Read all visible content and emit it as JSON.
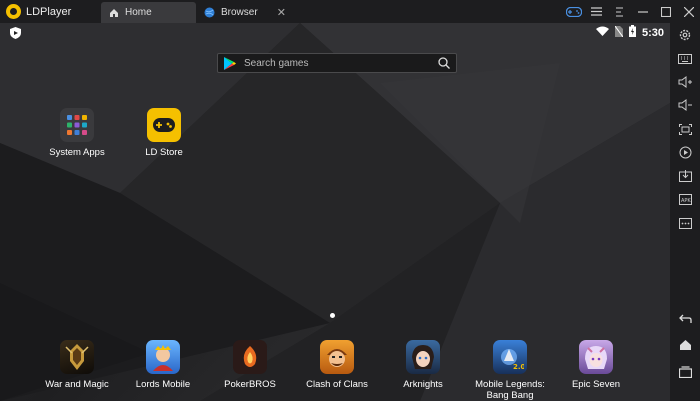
{
  "window": {
    "app_title": "LDPlayer",
    "tabs": [
      {
        "label": "Home",
        "icon": "home-icon",
        "active": true
      },
      {
        "label": "Browser",
        "icon": "globe-icon",
        "active": false
      }
    ],
    "controls": [
      "gamepad-icon",
      "menu-icon",
      "restore-icon",
      "minimize-icon",
      "maximize-icon",
      "close-icon"
    ]
  },
  "status": {
    "time": "5:30",
    "icons": [
      "wifi-icon",
      "no-sim-icon",
      "battery-icon"
    ]
  },
  "search": {
    "placeholder": "Search games"
  },
  "desktop_apps": [
    {
      "label": "System Apps",
      "icon": "system-apps-icon"
    },
    {
      "label": "LD Store",
      "icon": "ld-store-icon"
    }
  ],
  "dock_apps": [
    {
      "label": "War and Magic"
    },
    {
      "label": "Lords Mobile"
    },
    {
      "label": "PokerBROS"
    },
    {
      "label": "Clash of Clans"
    },
    {
      "label": "Arknights"
    },
    {
      "label": "Mobile Legends: Bang Bang",
      "line1": "Mobile Legends:",
      "line2": "Bang Bang"
    },
    {
      "label": "Epic Seven"
    }
  ],
  "toolbar_icons": [
    "settings-icon",
    "keyboard-icon",
    "volume-up-icon",
    "volume-down-icon",
    "fullscreen-icon",
    "record-icon",
    "install-apk-icon",
    "fps-icon",
    "more-icon",
    "back-icon",
    "home-nav-icon",
    "recent-apps-icon"
  ],
  "colors": {
    "accent_yellow": "#f5c000",
    "titlebar": "#1d1d1f",
    "active_tab": "#3a3a3d",
    "gamepad_blue": "#4a90e2"
  }
}
